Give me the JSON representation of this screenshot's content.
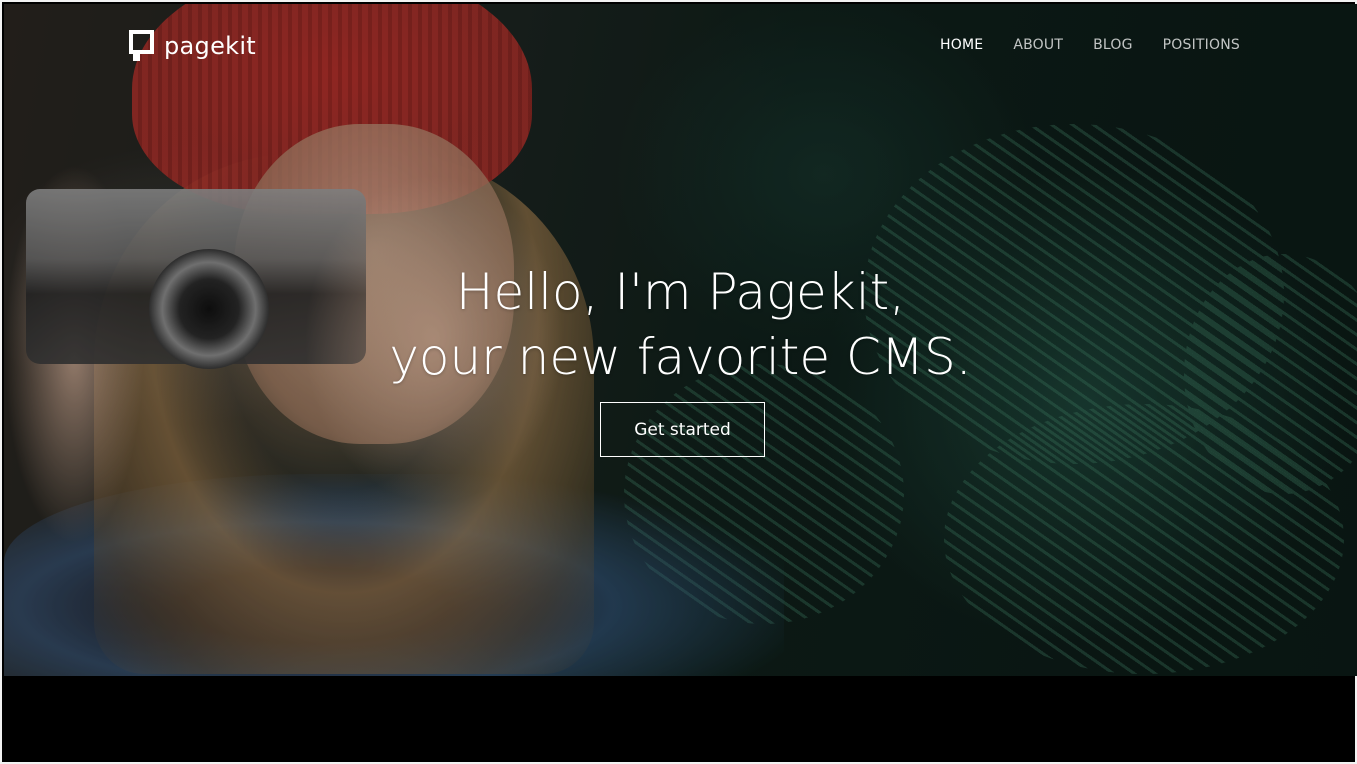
{
  "brand": {
    "name": "pagekit",
    "logo_icon": "pagekit-logo-icon"
  },
  "nav": {
    "items": [
      {
        "label": "HOME",
        "active": true
      },
      {
        "label": "ABOUT",
        "active": false
      },
      {
        "label": "BLOG",
        "active": false
      },
      {
        "label": "POSITIONS",
        "active": false
      }
    ]
  },
  "hero": {
    "headline_line1": "Hello, I'm Pagekit,",
    "headline_line2": "your new favorite CMS.",
    "cta_label": "Get started"
  },
  "colors": {
    "text": "#ffffff",
    "footer_band": "#000000"
  }
}
